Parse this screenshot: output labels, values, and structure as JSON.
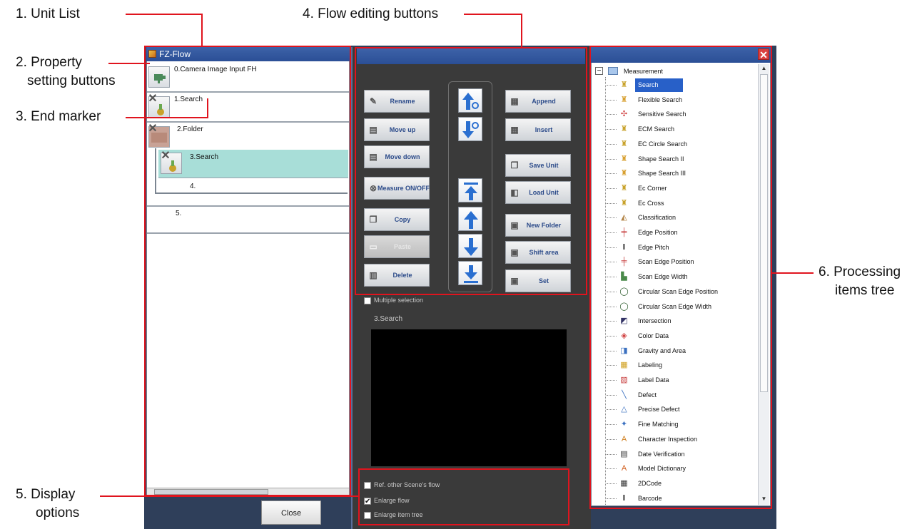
{
  "callouts": {
    "unit_list": "1. Unit List",
    "property_line1": "2. Property",
    "property_line2": "setting buttons",
    "end_marker": "3. End marker",
    "flow_editing": "4. Flow editing buttons",
    "display_line1": "5. Display",
    "display_line2": "options",
    "processing_line1": "6. Processing",
    "processing_line2": "items tree"
  },
  "window": {
    "title": "FZ-Flow"
  },
  "unit_list": {
    "rows": [
      {
        "label": "0.Camera Image Input FH"
      },
      {
        "label": "1.Search"
      },
      {
        "label": "2.Folder"
      },
      {
        "label": "3.Search"
      },
      {
        "label": "4."
      },
      {
        "label": "5."
      }
    ]
  },
  "flow_buttons": {
    "rename": "Rename",
    "move_up": "Move up",
    "move_down": "Move down",
    "measure_onoff": "Measure ON/OFF",
    "copy": "Copy",
    "paste": "Paste",
    "delete": "Delete",
    "append": "Append",
    "insert": "Insert",
    "save_unit": "Save Unit",
    "load_unit": "Load Unit",
    "new_folder": "New Folder",
    "shift_area": "Shift area",
    "set": "Set"
  },
  "multiple_selection": "Multiple selection",
  "preview_title": "3.Search",
  "display_options": {
    "ref_other": {
      "label": "Ref. other Scene's flow",
      "checked": false
    },
    "enlarge_flow": {
      "label": "Enlarge flow",
      "checked": true
    },
    "enlarge_tree": {
      "label": "Enlarge item tree",
      "checked": false
    }
  },
  "close_button": "Close",
  "tree": {
    "root_label": "Measurement",
    "items": [
      "Search",
      "Flexible Search",
      "Sensitive Search",
      "ECM Search",
      "EC Circle Search",
      "Shape Search II",
      "Shape Search III",
      "Ec Corner",
      "Ec Cross",
      "Classification",
      "Edge Position",
      "Edge Pitch",
      "Scan Edge Position",
      "Scan Edge Width",
      "Circular Scan Edge Position",
      "Circular Scan Edge Width",
      "Intersection",
      "Color Data",
      "Gravity and Area",
      "Labeling",
      "Label Data",
      "Defect",
      "Precise Defect",
      "Fine Matching",
      "Character Inspection",
      "Date Verification",
      "Model Dictionary",
      "2DCode",
      "Barcode"
    ],
    "selected": "Search"
  },
  "colors": {
    "callout_red": "#e0141e",
    "title_blue": "#2b4f96",
    "selected_row": "#a8ded8",
    "tree_selected": "#2860c8"
  }
}
